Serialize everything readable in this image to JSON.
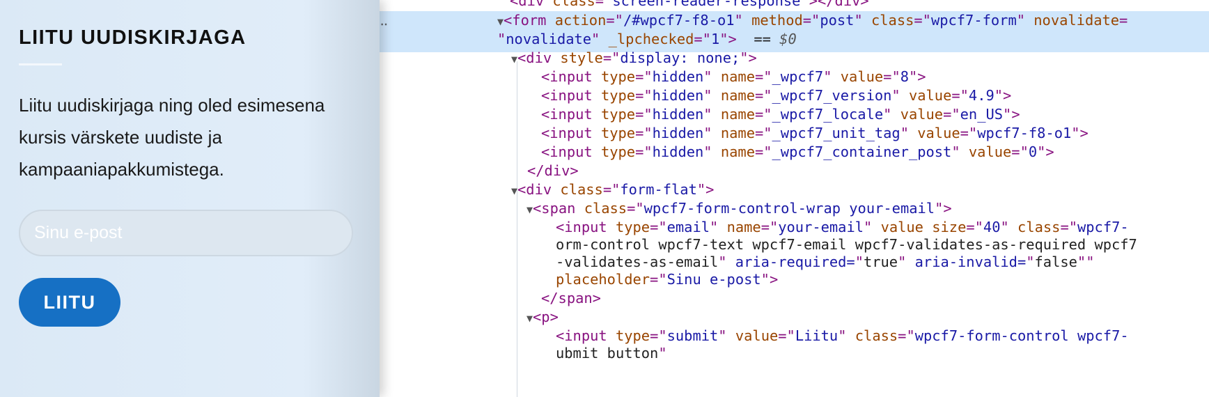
{
  "widget": {
    "title": "LIITU UUDISKIRJAGA",
    "text": "Liitu uudiskirjaga ning oled esimesena kursis värskete uudiste ja kampaaniapakkumistega.",
    "email_placeholder": "Sinu e-post",
    "submit_label": "LIITU"
  },
  "devtools": {
    "selected_marker": "‥",
    "lines": [
      "<div class=\"screen-reader-response\"></div>",
      "▼<form action=\"/#wpcf7-f8-o1\" method=\"post\" class=\"wpcf7-form\" novalidate=",
      "\"novalidate\" _lpchecked=\"1\"> == $0",
      "▼<div style=\"display: none;\">",
      "<input type=\"hidden\" name=\"_wpcf7\" value=\"8\">",
      "<input type=\"hidden\" name=\"_wpcf7_version\" value=\"4.9\">",
      "<input type=\"hidden\" name=\"_wpcf7_locale\" value=\"en_US\">",
      "<input type=\"hidden\" name=\"_wpcf7_unit_tag\" value=\"wpcf7-f8-o1\">",
      "<input type=\"hidden\" name=\"_wpcf7_container_post\" value=\"0\">",
      "</div>",
      "▼<div class=\"form-flat\">",
      "▼<span class=\"wpcf7-form-control-wrap your-email\">",
      "<input type=\"email\" name=\"your-email\" value size=\"40\" class=\"wpcf7-f",
      "orm-control wpcf7-text wpcf7-email wpcf7-validates-as-required wpcf7",
      "-validates-as-email\" aria-required=\"true\" aria-invalid=\"false\"",
      "placeholder=\"Sinu e-post\">",
      "</span>",
      "▼<p>",
      "<input type=\"submit\" value=\"Liitu\" class=\"wpcf7-form-control wpcf7-s",
      "ubmit button\">"
    ]
  }
}
